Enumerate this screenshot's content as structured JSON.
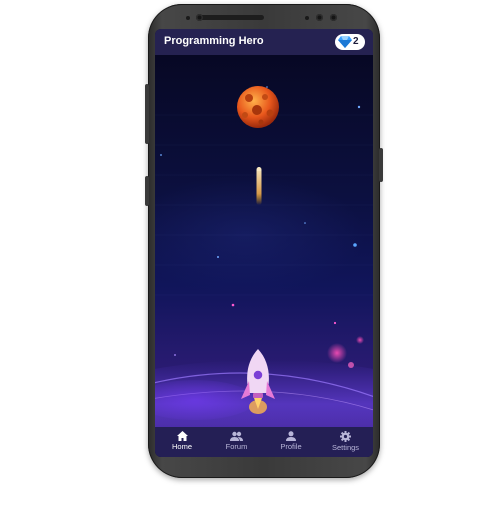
{
  "app": {
    "title": "Programming Hero",
    "gems": "2"
  },
  "nav": {
    "items": [
      {
        "label": "Home",
        "icon": "home-icon",
        "active": true
      },
      {
        "label": "Forum",
        "icon": "people-icon",
        "active": false
      },
      {
        "label": "Profile",
        "icon": "person-icon",
        "active": false
      },
      {
        "label": "Settings",
        "icon": "gear-icon",
        "active": false
      }
    ]
  },
  "colors": {
    "appbar": "#252251",
    "nav": "#241f55",
    "accent_gem": "#3aa0ff"
  }
}
